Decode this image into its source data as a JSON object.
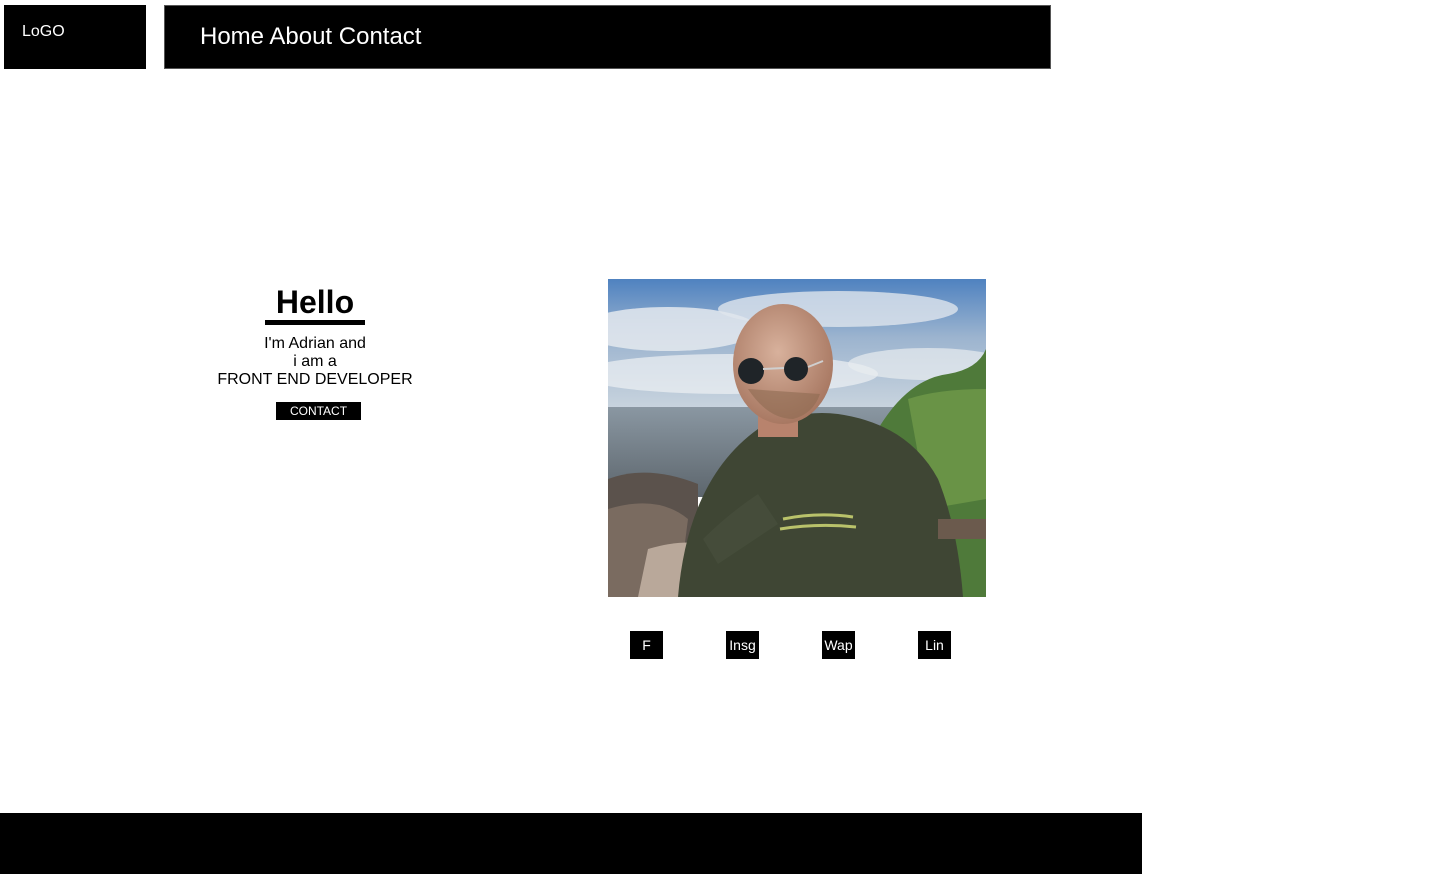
{
  "header": {
    "logo": "LoGO",
    "nav": [
      "Home",
      "About",
      "Contact"
    ]
  },
  "intro": {
    "greeting": "Hello",
    "line1": "I'm Adrian and",
    "line2": "i am a",
    "role": "FRONT END DEVELOPER",
    "contact_label": "CONTACT"
  },
  "social": [
    "F",
    "Insg",
    "Wap",
    "Lin"
  ],
  "colors": {
    "background": "#ffffff",
    "bars": "#000000",
    "text_on_dark": "#ffffff"
  }
}
